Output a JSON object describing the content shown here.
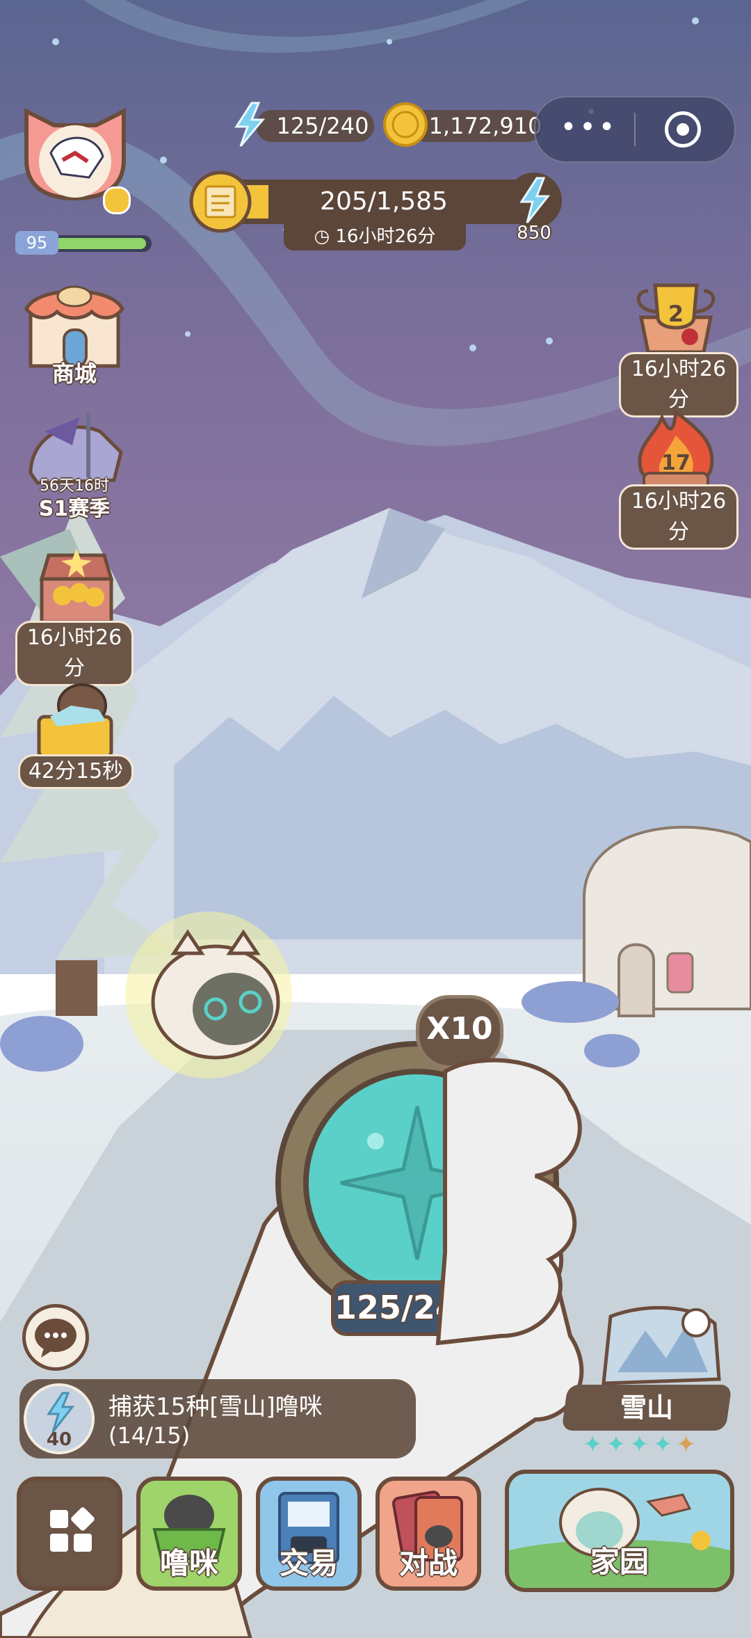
{
  "resources": {
    "energy": "125/240",
    "coins": "1,172,910",
    "level": "95"
  },
  "quest_bar": {
    "progress_text": "205/1,585",
    "timer": "16小时26分",
    "reward": "850",
    "progress": 0.13
  },
  "left_menu": {
    "shop_label": "商城",
    "season_time": "56天16时",
    "season_label": "S1赛季",
    "chest_timer": "16小时26分",
    "gift_timer": "42分15秒"
  },
  "right_menu": {
    "trophy_count": "2",
    "trophy_timer": "16小时26分",
    "fire_count": "17",
    "fire_timer": "16小时26分"
  },
  "capture": {
    "multiplier": "X10",
    "counter": "125/240"
  },
  "task": {
    "cost": "40",
    "title": "捕获15种[雪山]噜咪",
    "progress": "(14/15)"
  },
  "location": {
    "name": "雪山",
    "stars": 5
  },
  "bottom_nav": {
    "items": [
      {
        "label": "噜咪"
      },
      {
        "label": "交易"
      },
      {
        "label": "对战"
      },
      {
        "label": "家园"
      }
    ]
  },
  "colors": {
    "sky_top": "#5a6690",
    "sky_mid": "#8a7aa2",
    "snow": "#dfe6ec",
    "panel_brown": "#5c463a",
    "gold": "#f3c33b",
    "teal": "#5ad0c8"
  }
}
